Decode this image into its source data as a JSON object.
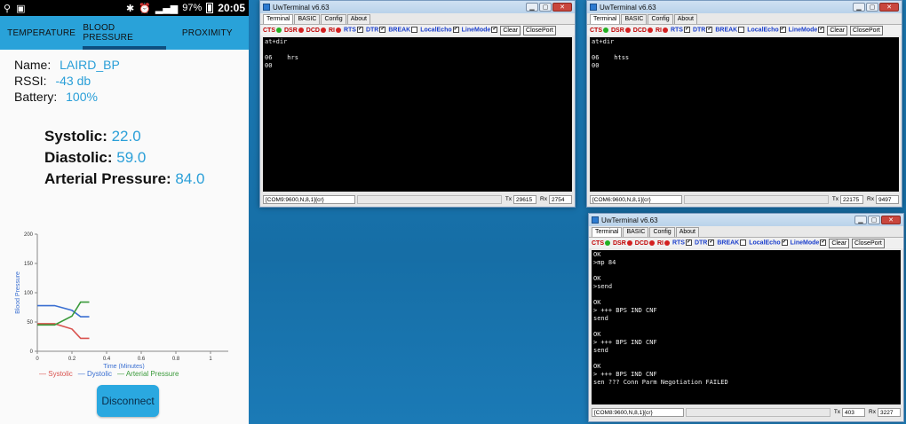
{
  "phone": {
    "status": {
      "battery": "97%",
      "time": "20:05"
    },
    "tabs": [
      "TEMPERATURE",
      "BLOOD PRESSURE",
      "PROXIMITY"
    ],
    "info": [
      {
        "label": "Name:",
        "value": "LAIRD_BP"
      },
      {
        "label": "RSSI:",
        "value": "-43 db"
      },
      {
        "label": "Battery:",
        "value": "100%"
      }
    ],
    "readings": [
      {
        "label": "Systolic:",
        "value": "22.0"
      },
      {
        "label": "Diastolic:",
        "value": "59.0"
      },
      {
        "label": "Arterial Pressure:",
        "value": "84.0"
      }
    ],
    "disconnect_label": "Disconnect"
  },
  "chart_data": {
    "type": "line",
    "xlabel": "Time (Minutes)",
    "ylabel": "Blood Pressure",
    "xlim": [
      0,
      1
    ],
    "ylim": [
      0,
      200
    ],
    "x_ticks": [
      "0",
      "0.2",
      "0.4",
      "0.6",
      "0.8",
      "1"
    ],
    "y_ticks": [
      "0",
      "50",
      "100",
      "150",
      "200"
    ],
    "series": [
      {
        "name": "Systolic",
        "color": "#d9534f",
        "x": [
          0,
          0.1,
          0.2,
          0.25,
          0.3
        ],
        "y": [
          47,
          47,
          38,
          22,
          22
        ]
      },
      {
        "name": "Dystolic",
        "color": "#3a6fd1",
        "x": [
          0,
          0.1,
          0.2,
          0.25,
          0.3
        ],
        "y": [
          78,
          78,
          70,
          59,
          59
        ]
      },
      {
        "name": "Arterial Pressure",
        "color": "#3a9a3a",
        "x": [
          0,
          0.1,
          0.2,
          0.25,
          0.3
        ],
        "y": [
          45,
          45,
          60,
          84,
          84
        ]
      }
    ]
  },
  "windows": [
    {
      "title": "UwTerminal v6.63",
      "tabs": [
        "Terminal",
        "BASIC",
        "Config",
        "About"
      ],
      "console": "at+dir\n\n06    hrs\n00",
      "port": "[COM9:9600,N,8,1]{cr}",
      "tx": "29615",
      "rx": "2754"
    },
    {
      "title": "UwTerminal v6.63",
      "tabs": [
        "Terminal",
        "BASIC",
        "Config",
        "About"
      ],
      "console": "at+dir\n\n06    htss\n00",
      "port": "[COM6:9600,N,8,1]{cr}",
      "tx": "22175",
      "rx": "9497"
    },
    {
      "title": "UwTerminal v6.63",
      "tabs": [
        "Terminal",
        "BASIC",
        "Config",
        "About"
      ],
      "console": "OK\n>mp 84\n\nOK\n>send\n\nOK\n> +++ BPS IND CNF\nsend\n\nOK\n> +++ BPS IND CNF\nsend\n\nOK\n> +++ BPS IND CNF\nsen ??? Conn Parm Negotiation FAILED",
      "port": "[COM8:9600,N,8,1]{cr}",
      "tx": "403",
      "rx": "3227"
    }
  ],
  "controls": {
    "cts": "CTS",
    "dsr": "DSR",
    "dcd": "DCD",
    "ri": "RI",
    "rts": "RTS",
    "dtr": "DTR",
    "brk": "BREAK",
    "localecho": "LocalEcho",
    "linemode": "LineMode",
    "clear": "Clear",
    "closeport": "ClosePort",
    "tx_label": "Tx",
    "rx_label": "Rx"
  }
}
